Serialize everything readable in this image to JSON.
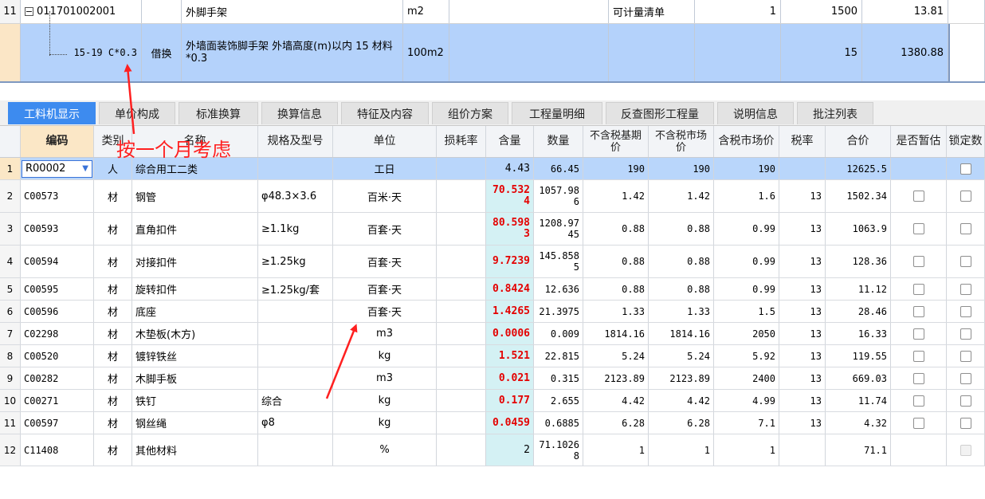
{
  "top_rows": [
    {
      "row_no": "11",
      "code": "011701002001",
      "type": "",
      "name": "外脚手架",
      "unit": "m2",
      "spec": "",
      "category": "可计量清单",
      "qty_expr": "1",
      "qty": "1500",
      "unit_price": "13.81"
    },
    {
      "row_no": "",
      "code": "15-19 C*0.3",
      "type": "借换",
      "name": "外墙面装饰脚手架 外墙高度(m)以内 15 材料*0.3",
      "unit": "100m2",
      "spec": "",
      "category": "",
      "qty_expr": "",
      "qty": "15",
      "unit_price": "1380.88"
    }
  ],
  "tabs": [
    {
      "label": "工料机显示",
      "active": true
    },
    {
      "label": "单价构成",
      "active": false
    },
    {
      "label": "标准换算",
      "active": false
    },
    {
      "label": "换算信息",
      "active": false
    },
    {
      "label": "特征及内容",
      "active": false
    },
    {
      "label": "组价方案",
      "active": false
    },
    {
      "label": "工程量明细",
      "active": false
    },
    {
      "label": "反查图形工程量",
      "active": false
    },
    {
      "label": "说明信息",
      "active": false
    },
    {
      "label": "批注列表",
      "active": false
    }
  ],
  "columns": [
    {
      "key": "rn",
      "label": ""
    },
    {
      "key": "code",
      "label": "编码"
    },
    {
      "key": "type",
      "label": "类别"
    },
    {
      "key": "name",
      "label": "名称"
    },
    {
      "key": "spec",
      "label": "规格及型号"
    },
    {
      "key": "unit",
      "label": "单位"
    },
    {
      "key": "loss",
      "label": "损耗率"
    },
    {
      "key": "content",
      "label": "含量"
    },
    {
      "key": "amount",
      "label": "数量"
    },
    {
      "key": "base_price",
      "label": "不含税基期价"
    },
    {
      "key": "market_price",
      "label": "不含税市场价"
    },
    {
      "key": "tax_market_price",
      "label": "含税市场价"
    },
    {
      "key": "tax_rate",
      "label": "税率"
    },
    {
      "key": "total",
      "label": "合价"
    },
    {
      "key": "provisional",
      "label": "是否暂估"
    },
    {
      "key": "locked",
      "label": "锁定数"
    }
  ],
  "rows": [
    {
      "rn": "1",
      "code": "R00002",
      "type": "人",
      "name": "综合用工二类",
      "spec": "",
      "unit": "工日",
      "loss": "",
      "content": "4.43",
      "amount": "66.45",
      "base_price": "190",
      "market_price": "190",
      "tax_market_price": "190",
      "tax_rate": "",
      "total": "12625.5",
      "provisional": false,
      "locked": "checkbox"
    },
    {
      "rn": "2",
      "code": "C00573",
      "type": "材",
      "name": "钢管",
      "spec": "φ48.3×3.6",
      "unit": "百米·天",
      "loss": "",
      "content": "70.5324",
      "amount": "1057.986",
      "base_price": "1.42",
      "market_price": "1.42",
      "tax_market_price": "1.6",
      "tax_rate": "13",
      "total": "1502.34",
      "provisional": true,
      "locked": "checkbox"
    },
    {
      "rn": "3",
      "code": "C00593",
      "type": "材",
      "name": "直角扣件",
      "spec": "≥1.1kg",
      "unit": "百套·天",
      "loss": "",
      "content": "80.5983",
      "amount": "1208.9745",
      "base_price": "0.88",
      "market_price": "0.88",
      "tax_market_price": "0.99",
      "tax_rate": "13",
      "total": "1063.9",
      "provisional": true,
      "locked": "checkbox"
    },
    {
      "rn": "4",
      "code": "C00594",
      "type": "材",
      "name": "对接扣件",
      "spec": "≥1.25kg",
      "unit": "百套·天",
      "loss": "",
      "content": "9.7239",
      "amount": "145.8585",
      "base_price": "0.88",
      "market_price": "0.88",
      "tax_market_price": "0.99",
      "tax_rate": "13",
      "total": "128.36",
      "provisional": true,
      "locked": "checkbox"
    },
    {
      "rn": "5",
      "code": "C00595",
      "type": "材",
      "name": "旋转扣件",
      "spec": "≥1.25kg/套",
      "unit": "百套·天",
      "loss": "",
      "content": "0.8424",
      "amount": "12.636",
      "base_price": "0.88",
      "market_price": "0.88",
      "tax_market_price": "0.99",
      "tax_rate": "13",
      "total": "11.12",
      "provisional": true,
      "locked": "checkbox"
    },
    {
      "rn": "6",
      "code": "C00596",
      "type": "材",
      "name": "底座",
      "spec": "",
      "unit": "百套·天",
      "loss": "",
      "content": "1.4265",
      "amount": "21.3975",
      "base_price": "1.33",
      "market_price": "1.33",
      "tax_market_price": "1.5",
      "tax_rate": "13",
      "total": "28.46",
      "provisional": true,
      "locked": "checkbox"
    },
    {
      "rn": "7",
      "code": "C02298",
      "type": "材",
      "name": "木垫板(木方)",
      "spec": "",
      "unit": "m3",
      "loss": "",
      "content": "0.0006",
      "amount": "0.009",
      "base_price": "1814.16",
      "market_price": "1814.16",
      "tax_market_price": "2050",
      "tax_rate": "13",
      "total": "16.33",
      "provisional": true,
      "locked": "checkbox"
    },
    {
      "rn": "8",
      "code": "C00520",
      "type": "材",
      "name": "镀锌铁丝",
      "spec": "",
      "unit": "kg",
      "loss": "",
      "content": "1.521",
      "amount": "22.815",
      "base_price": "5.24",
      "market_price": "5.24",
      "tax_market_price": "5.92",
      "tax_rate": "13",
      "total": "119.55",
      "provisional": true,
      "locked": "checkbox"
    },
    {
      "rn": "9",
      "code": "C00282",
      "type": "材",
      "name": "木脚手板",
      "spec": "",
      "unit": "m3",
      "loss": "",
      "content": "0.021",
      "amount": "0.315",
      "base_price": "2123.89",
      "market_price": "2123.89",
      "tax_market_price": "2400",
      "tax_rate": "13",
      "total": "669.03",
      "provisional": true,
      "locked": "checkbox"
    },
    {
      "rn": "10",
      "code": "C00271",
      "type": "材",
      "name": "铁钉",
      "spec": "综合",
      "unit": "kg",
      "loss": "",
      "content": "0.177",
      "amount": "2.655",
      "base_price": "4.42",
      "market_price": "4.42",
      "tax_market_price": "4.99",
      "tax_rate": "13",
      "total": "11.74",
      "provisional": true,
      "locked": "checkbox"
    },
    {
      "rn": "11",
      "code": "C00597",
      "type": "材",
      "name": "钢丝绳",
      "spec": "φ8",
      "unit": "kg",
      "loss": "",
      "content": "0.0459",
      "amount": "0.6885",
      "base_price": "6.28",
      "market_price": "6.28",
      "tax_market_price": "7.1",
      "tax_rate": "13",
      "total": "4.32",
      "provisional": true,
      "locked": "checkbox"
    },
    {
      "rn": "12",
      "code": "C11408",
      "type": "材",
      "name": "其他材料",
      "spec": "",
      "unit": "%",
      "loss": "",
      "content": "2",
      "amount": "71.10268",
      "base_price": "1",
      "market_price": "1",
      "tax_market_price": "1",
      "tax_rate": "",
      "total": "71.1",
      "provisional": false,
      "locked": "disabled"
    }
  ],
  "annotation": {
    "text": "按一个月考虑",
    "color": "#ff2020"
  },
  "colors": {
    "selected_row": "#b9d6fb",
    "active_tab": "#3d8bef",
    "highlight_qty": "#e40000",
    "qty_cell_bg": "#d4f1f4",
    "header_highlight": "#fbe7c6"
  }
}
